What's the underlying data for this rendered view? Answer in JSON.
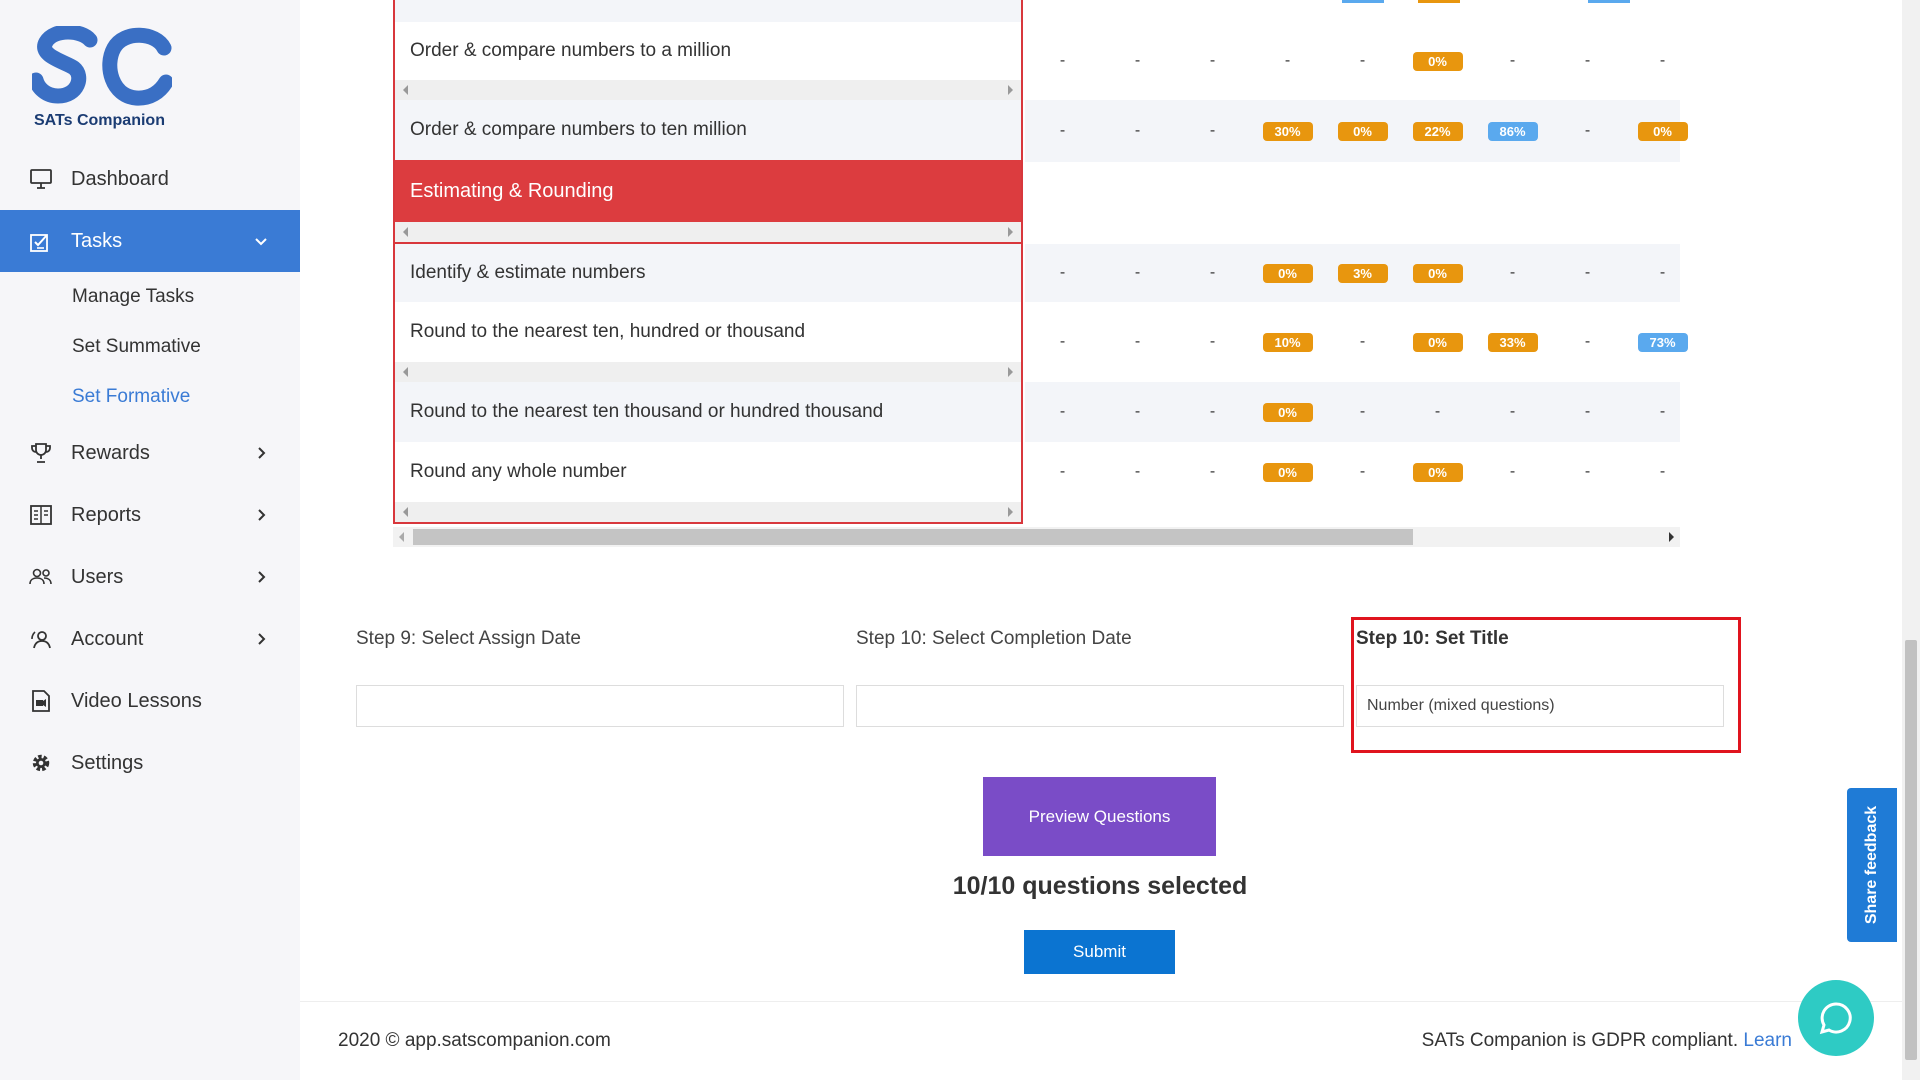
{
  "brand": {
    "logo_text": "SATs Companion",
    "logo_mark": "SC",
    "color_blue": "#3a6fc4",
    "color_navy": "#1b3c73"
  },
  "sidebar": {
    "items": [
      {
        "label": "Dashboard",
        "icon": "monitor-icon"
      },
      {
        "label": "Tasks",
        "icon": "tasks-icon",
        "expanded": true
      },
      {
        "label": "Rewards",
        "icon": "trophy-icon"
      },
      {
        "label": "Reports",
        "icon": "reports-icon"
      },
      {
        "label": "Users",
        "icon": "users-icon"
      },
      {
        "label": "Account",
        "icon": "account-icon"
      },
      {
        "label": "Video Lessons",
        "icon": "video-icon"
      },
      {
        "label": "Settings",
        "icon": "gear-icon"
      }
    ],
    "tasks_sub": [
      "Manage Tasks",
      "Set Summative",
      "Set Formative"
    ],
    "current_sub": "Set Formative"
  },
  "table": {
    "rows": [
      {
        "label": "Order & compare numbers to a million",
        "cells": [
          "-",
          "-",
          "-",
          "-",
          "-",
          "0%",
          "-",
          "-",
          "-"
        ]
      },
      {
        "label": "Order & compare numbers to ten million",
        "cells": [
          "-",
          "-",
          "-",
          "30%",
          "0%",
          "22%",
          "86%",
          "-",
          "0%"
        ]
      },
      {
        "section": "Estimating & Rounding"
      },
      {
        "label": "Identify & estimate numbers",
        "cells": [
          "-",
          "-",
          "-",
          "0%",
          "3%",
          "0%",
          "-",
          "-",
          "-"
        ]
      },
      {
        "label": "Round to the nearest ten, hundred or thousand",
        "cells": [
          "-",
          "-",
          "-",
          "10%",
          "-",
          "0%",
          "33%",
          "-",
          "73%"
        ]
      },
      {
        "label": "Round to the nearest ten thousand or hundred thousand",
        "cells": [
          "-",
          "-",
          "-",
          "0%",
          "-",
          "-",
          "-",
          "-",
          "-"
        ]
      },
      {
        "label": "Round any whole number",
        "cells": [
          "-",
          "-",
          "-",
          "0%",
          "-",
          "0%",
          "-",
          "-",
          "-"
        ]
      }
    ]
  },
  "form": {
    "step9_label": "Step 9: Select Assign Date",
    "step9_value": "",
    "step10_date_label": "Step 10: Select Completion Date",
    "step10_date_value": "",
    "step10_title_label": "Step 10: Set Title",
    "step10_title_value": "Number (mixed questions)",
    "preview_button": "Preview Questions",
    "selected_count": "10/10 questions selected",
    "submit_button": "Submit"
  },
  "footer": {
    "copyright": "2020 © app.satscompanion.com",
    "gdpr_text": "SATs Companion is GDPR compliant. ",
    "gdpr_link": "Learn"
  },
  "feedback_label": "Share feedback",
  "colors": {
    "accent": "#3a7bd5",
    "section_red": "#dc3c3f",
    "badge_orange": "#e8960e",
    "badge_blue": "#5aa9ee",
    "preview_purple": "#7a4cc7",
    "submit_blue": "#0b74d1",
    "chat_teal": "#2ecbc4"
  }
}
